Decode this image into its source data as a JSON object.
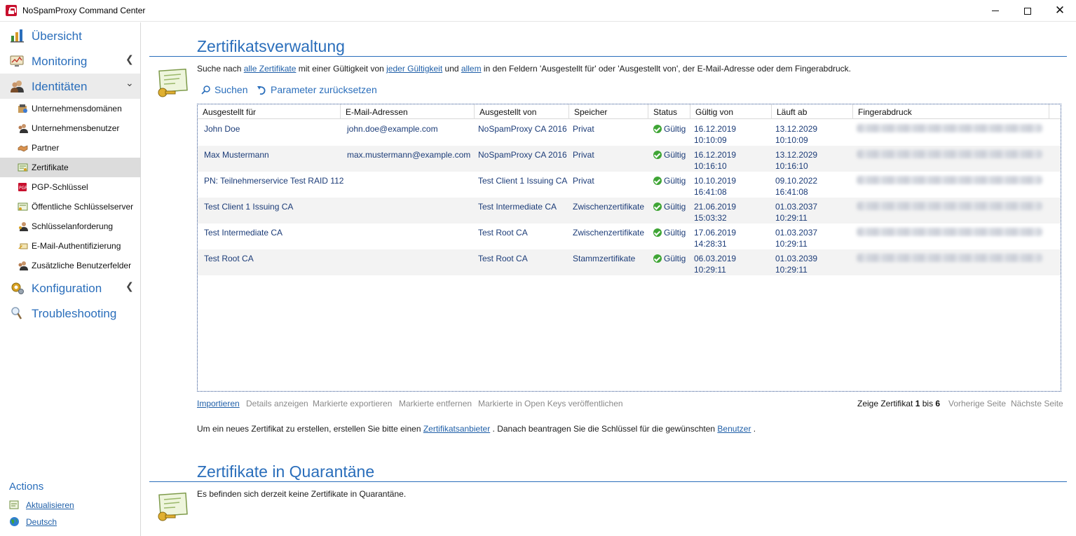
{
  "window": {
    "title": "NoSpamProxy Command Center"
  },
  "sidebar": {
    "top": [
      {
        "label": "Übersicht",
        "icon": "chart-icon",
        "chevron": ""
      },
      {
        "label": "Monitoring",
        "icon": "monitor-icon",
        "chevron": "‹"
      },
      {
        "label": "Identitäten",
        "icon": "users-icon",
        "chevron": "⌄"
      }
    ],
    "sub": [
      {
        "label": "Unternehmensdomänen",
        "icon": "domain-icon"
      },
      {
        "label": "Unternehmensbenutzer",
        "icon": "user-icon"
      },
      {
        "label": "Partner",
        "icon": "handshake-icon"
      },
      {
        "label": "Zertifikate",
        "icon": "certificate-icon"
      },
      {
        "label": "PGP-Schlüssel",
        "icon": "pgp-icon"
      },
      {
        "label": "Öffentliche Schlüsselserver",
        "icon": "keyserver-icon"
      },
      {
        "label": "Schlüsselanforderung",
        "icon": "key-request-icon"
      },
      {
        "label": "E-Mail-Authentifizierung",
        "icon": "mail-auth-icon"
      },
      {
        "label": "Zusätzliche Benutzerfelder",
        "icon": "user-fields-icon"
      }
    ],
    "bottom": [
      {
        "label": "Konfiguration",
        "icon": "gear-icon",
        "chevron": "‹"
      },
      {
        "label": "Troubleshooting",
        "icon": "magnifier-icon",
        "chevron": ""
      }
    ],
    "actions_title": "Actions",
    "actions": [
      {
        "label": "Aktualisieren",
        "icon": "refresh-icon"
      },
      {
        "label": "Deutsch",
        "icon": "globe-icon"
      }
    ]
  },
  "main": {
    "title": "Zertifikatsverwaltung",
    "search": {
      "p1": "Suche nach ",
      "l1": "alle Zertifikate",
      "p2": " mit einer Gültigkeit von ",
      "l2": "jeder Gültigkeit",
      "p3": " und ",
      "l3": "allem",
      "p4": " in den Feldern 'Ausgestellt für' oder 'Ausgestellt von', der E-Mail-Adresse oder dem Fingerabdruck."
    },
    "search_button": "Suchen",
    "reset_button": "Parameter zurücksetzen",
    "columns": [
      "Ausgestellt für",
      "E-Mail-Adressen",
      "Ausgestellt von",
      "Speicher",
      "Status",
      "Gültig von",
      "Läuft ab",
      "Fingerabdruck"
    ],
    "rows": [
      {
        "issued_to": "John Doe",
        "email": "john.doe@example.com",
        "issued_by": "NoSpamProxy CA 2016",
        "store": "Privat",
        "status": "Gültig",
        "valid_from_date": "16.12.2019",
        "valid_from_time": "10:10:09",
        "expires_date": "13.12.2029",
        "expires_time": "10:10:09"
      },
      {
        "issued_to": "Max Mustermann",
        "email": "max.mustermann@example.com",
        "issued_by": "NoSpamProxy CA 2016",
        "store": "Privat",
        "status": "Gültig",
        "valid_from_date": "16.12.2019",
        "valid_from_time": "10:16:10",
        "expires_date": "13.12.2029",
        "expires_time": "10:16:10"
      },
      {
        "issued_to": "PN: Teilnehmerservice Test RAID 112",
        "email": "",
        "issued_by": "Test Client 1 Issuing CA",
        "store": "Privat",
        "status": "Gültig",
        "valid_from_date": "10.10.2019",
        "valid_from_time": "16:41:08",
        "expires_date": "09.10.2022",
        "expires_time": "16:41:08"
      },
      {
        "issued_to": "Test Client 1 Issuing CA",
        "email": "",
        "issued_by": "Test Intermediate CA",
        "store": "Zwischenzertifikate",
        "status": "Gültig",
        "valid_from_date": "21.06.2019",
        "valid_from_time": "15:03:32",
        "expires_date": "01.03.2037",
        "expires_time": "10:29:11"
      },
      {
        "issued_to": "Test Intermediate CA",
        "email": "",
        "issued_by": "Test Root CA",
        "store": "Zwischenzertifikate",
        "status": "Gültig",
        "valid_from_date": "17.06.2019",
        "valid_from_time": "14:28:31",
        "expires_date": "01.03.2037",
        "expires_time": "10:29:11"
      },
      {
        "issued_to": "Test Root CA",
        "email": "",
        "issued_by": "Test Root CA",
        "store": "Stammzertifikate",
        "status": "Gültig",
        "valid_from_date": "06.03.2019",
        "valid_from_time": "10:29:11",
        "expires_date": "01.03.2039",
        "expires_time": "10:29:11"
      }
    ],
    "grid_actions": {
      "import": "Importieren",
      "details": "Details anzeigen",
      "export": "Markierte exportieren",
      "remove": "Markierte entfernen",
      "publish": "Markierte in Open Keys veröffentlichen"
    },
    "pager": {
      "prefix": "Zeige Zertifikat ",
      "from": "1",
      "mid": " bis ",
      "to": "6",
      "prev": "Vorherige Seite",
      "next": "Nächste Seite"
    },
    "info": {
      "p1": "Um ein neues Zertifikat zu erstellen, erstellen Sie bitte einen ",
      "l1": "Zertifikatsanbieter",
      "p2": " . Danach beantragen Sie die Schlüssel für die gewünschten ",
      "l2": "Benutzer",
      "p3": " ."
    },
    "quarantine_title": "Zertifikate in Quarantäne",
    "quarantine_text": "Es befinden sich derzeit keine Zertifikate in Quarantäne."
  },
  "colors": {
    "accent": "#2a6ebb",
    "link": "#1f5fa8",
    "valid": "#3fa535"
  }
}
